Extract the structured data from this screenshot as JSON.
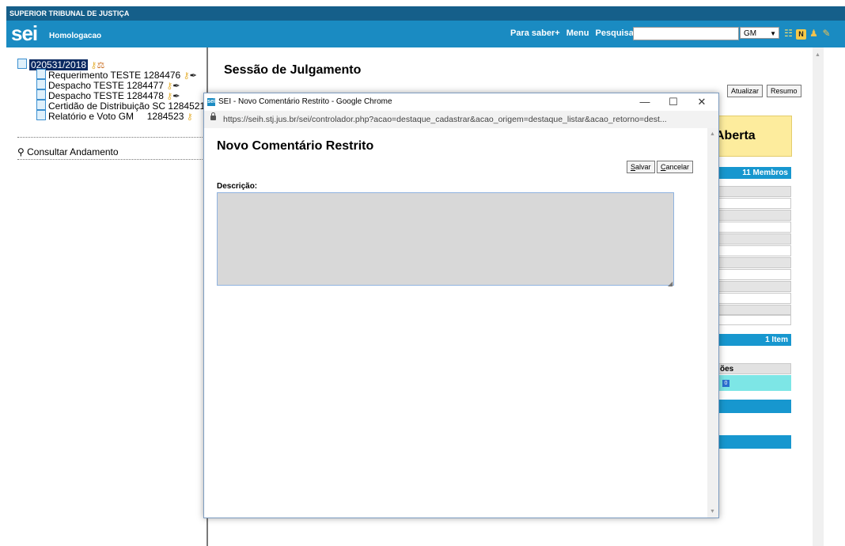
{
  "topbar": {
    "org": "SUPERIOR TRIBUNAL DE JUSTIÇA"
  },
  "header": {
    "logo": "sei",
    "env": "Homologacao",
    "links": [
      "Para saber+",
      "Menu",
      "Pesquisa"
    ],
    "unit": "GM",
    "icons": [
      "grid-icon",
      "n-icon",
      "user-icon",
      "wrench-icon"
    ]
  },
  "tree": {
    "process": "020531/2018",
    "docs": [
      {
        "label": "Requerimento TESTE 1284476"
      },
      {
        "label": "Despacho TESTE 1284477"
      },
      {
        "label": "Despacho TESTE 1284478"
      },
      {
        "label": "Certidão de Distribuição SC 1284521"
      },
      {
        "label": "Relatório e Voto GM     1284523"
      }
    ],
    "consult": "Consultar Andamento"
  },
  "main": {
    "title": "Sessão de Julgamento",
    "btn_atualizar": "Atualizar",
    "btn_resumo": "Resumo",
    "status": "Aberta",
    "members": "11 Membros",
    "items": "1 Item",
    "col_head_suffix": "ões",
    "badge": "0"
  },
  "popup": {
    "window_title": "SEI - Novo Comentário Restrito - Google Chrome",
    "url": "https://seih.stj.jus.br/sei/controlador.php?acao=destaque_cadastrar&acao_origem=destaque_listar&acao_retorno=dest...",
    "heading": "Novo Comentário Restrito",
    "btn_salvar_first": "S",
    "btn_salvar_rest": "alvar",
    "btn_cancelar_first": "C",
    "btn_cancelar_rest": "ancelar",
    "desc_label": "Descrição:",
    "desc_value": ""
  },
  "colors": {
    "header_blue": "#1a8bc2",
    "dark_blue": "#155f8a",
    "status_yellow": "#fdec9d"
  }
}
